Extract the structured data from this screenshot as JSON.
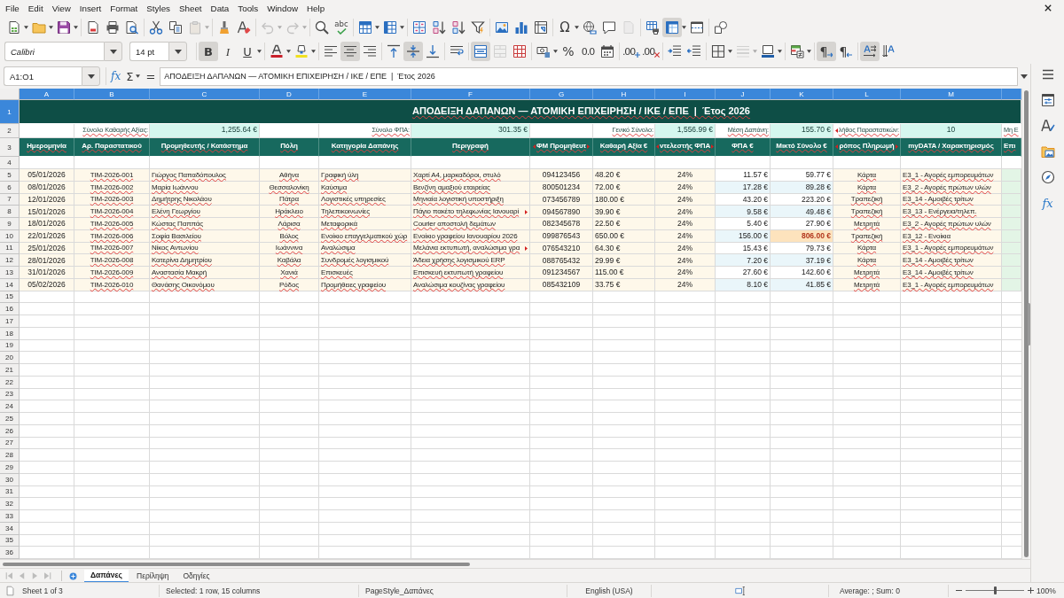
{
  "menu_bar": {
    "items": [
      "File",
      "Edit",
      "View",
      "Insert",
      "Format",
      "Styles",
      "Sheet",
      "Data",
      "Tools",
      "Window",
      "Help"
    ]
  },
  "standard_toolbar": {
    "paste_disabled": true,
    "undo_disabled": true,
    "redo_disabled": true,
    "header_footer_disabled": true,
    "freeze_on": true,
    "spelling_glyph": "abc",
    "special_character_glyph": "Ω"
  },
  "formatting_toolbar": {
    "font_name": "Calibri",
    "font_size": "14 pt",
    "text_styles": [
      {
        "kind": "bold",
        "glyph": "B",
        "on": true
      },
      {
        "kind": "italic",
        "glyph": "I",
        "on": false
      },
      {
        "kind": "underline",
        "glyph": "U",
        "on": false
      }
    ],
    "horizontal_align": [
      {
        "kind": "left",
        "selected": false
      },
      {
        "kind": "center",
        "selected": true
      },
      {
        "kind": "right",
        "selected": false
      }
    ],
    "vertical_align": [
      {
        "kind": "top",
        "selected": false
      },
      {
        "kind": "middle",
        "selected": true
      },
      {
        "kind": "bottom",
        "selected": false
      }
    ],
    "merge_and_center_on": true,
    "merge_cells_disabled": true,
    "percent_glyph": "%",
    "number_glyph": "0.0",
    "decimal_glyphs": [
      ".00",
      ".00"
    ],
    "border_style_disabled": true,
    "paragraph_directions": [
      {
        "kind": "ltr",
        "glyph": "¶",
        "selected": true
      },
      {
        "kind": "rtl",
        "glyph": "¶",
        "selected": false
      }
    ],
    "text_directions": [
      {
        "kind": "horizontal",
        "selected": true
      },
      {
        "kind": "vertical",
        "selected": false
      }
    ]
  },
  "formula_bar": {
    "name_box": "A1:O1",
    "function_glyph": "fx",
    "sum_glyph": "Σ",
    "equals_glyph": "=",
    "formula": "ΑΠΟΔΕΙΞΗ ΔΑΠΑΝΩΝ — ΑΤΟΜΙΚΗ ΕΠΙΧΕΙΡΗΣΗ / ΙΚΕ / ΕΠΕ  |  Έτος 2026"
  },
  "sheet": {
    "column_headers": [
      {
        "label": "A",
        "selected": true
      },
      {
        "label": "B",
        "selected": true
      },
      {
        "label": "C",
        "selected": true
      },
      {
        "label": "D",
        "selected": true
      },
      {
        "label": "E",
        "selected": true
      },
      {
        "label": "F",
        "selected": true
      },
      {
        "label": "G",
        "selected": true
      },
      {
        "label": "H",
        "selected": true
      },
      {
        "label": "I",
        "selected": true
      },
      {
        "label": "J",
        "selected": true
      },
      {
        "label": "K",
        "selected": true
      },
      {
        "label": "L",
        "selected": true
      },
      {
        "label": "M",
        "selected": true
      },
      {
        "selected": true
      }
    ],
    "row_headers": [
      {
        "label": "1",
        "selected": true
      },
      {
        "label": "2",
        "selected": false
      },
      {
        "label": "3",
        "selected": false
      },
      {
        "label": "4",
        "selected": false
      },
      {
        "label": "5",
        "selected": false
      },
      {
        "label": "6",
        "selected": false
      },
      {
        "label": "7",
        "selected": false
      },
      {
        "label": "8",
        "selected": false
      },
      {
        "label": "9",
        "selected": false
      },
      {
        "label": "10",
        "selected": false
      },
      {
        "label": "11",
        "selected": false
      },
      {
        "label": "12",
        "selected": false
      },
      {
        "label": "13",
        "selected": false
      },
      {
        "label": "14",
        "selected": false
      },
      {
        "label": "15",
        "selected": false
      },
      {
        "label": "16",
        "selected": false
      },
      {
        "label": "17",
        "selected": false
      },
      {
        "label": "18",
        "selected": false
      },
      {
        "label": "19",
        "selected": false
      },
      {
        "label": "20",
        "selected": false
      },
      {
        "label": "21",
        "selected": false
      },
      {
        "label": "22",
        "selected": false
      },
      {
        "label": "23",
        "selected": false
      },
      {
        "label": "24",
        "selected": false
      },
      {
        "label": "25",
        "selected": false
      },
      {
        "label": "26",
        "selected": false
      },
      {
        "label": "27",
        "selected": false
      },
      {
        "label": "28",
        "selected": false
      },
      {
        "label": "29",
        "selected": false
      },
      {
        "label": "30",
        "selected": false
      },
      {
        "label": "31",
        "selected": false
      },
      {
        "label": "32",
        "selected": false
      },
      {
        "label": "33",
        "selected": false
      },
      {
        "label": "34",
        "selected": false
      },
      {
        "label": "35",
        "selected": false
      },
      {
        "label": "36",
        "selected": false
      }
    ],
    "title": "ΑΠΟΔΕΙΞΗ ΔΑΠΑΝΩΝ — ΑΤΟΜΙΚΗ ΕΠΙΧΕΙΡΗΣΗ / ΙΚΕ / ΕΠΕ  |  Έτος 2026",
    "summary": [
      {
        "label": "Σύνολο Καθαρής Αξίας:",
        "value": "1,255.64 €",
        "clipped": false
      },
      {
        "label": "Σύνολο ΦΠΑ:",
        "value": "301.35 €",
        "clipped": false
      },
      {
        "label": "Γενικό Σύνολο:",
        "value": "1,556.99 €",
        "clipped": false
      },
      {
        "label": "Μέση Δαπάνη:",
        "value": "155.70 €",
        "clipped": false
      },
      {
        "label": "λήθος Παραστατικών:",
        "value": "10",
        "clipped": true
      },
      {
        "label": "Μη Ε",
        "clipped": false
      }
    ],
    "headers": [
      {
        "text": "Ημερομηνία",
        "clipped": false
      },
      {
        "text": "Αρ. Παραστατικού",
        "clipped": false
      },
      {
        "text": "Προμηθευτής / Κατάστημα",
        "clipped": false
      },
      {
        "text": "Πόλη",
        "clipped": false
      },
      {
        "text": "Κατηγορία Δαπάνης",
        "clipped": false
      },
      {
        "text": "Περιγραφή",
        "clipped": false
      },
      {
        "text": "ΦΜ Προμηθευτ",
        "clipped": true
      },
      {
        "text": "Καθαρή Αξία €",
        "clipped": false
      },
      {
        "text": "ντελεστής ΦΠΑ",
        "clipped": true
      },
      {
        "text": "ΦΠΑ €",
        "clipped": false
      },
      {
        "text": "Μικτό Σύνολο €",
        "clipped": false
      },
      {
        "text": "ρόπος Πληρωμή",
        "clipped": true
      },
      {
        "text": "myDATA / Χαρακτηρισμός",
        "clipped": false
      },
      {
        "text": "Επι",
        "clipped": false
      }
    ],
    "rows": [
      {
        "cells": [
          "05/01/2026",
          "ΤΙΜ-2026-001",
          "Γιώργος Παπαδόπουλος",
          "Αθήνα",
          "Γραφική ύλη",
          "Χαρτί Α4, μαρκαδόροι, στυλό",
          "094123456",
          "48.20 €",
          "24%",
          "11.57 €",
          "59.77 €",
          "Κάρτα",
          "Ε3_1 - Αγορές εμπορευμάτων"
        ],
        "description_clipped": false,
        "total_flagged": false
      },
      {
        "cells": [
          "08/01/2026",
          "ΤΙΜ-2026-002",
          "Μαρία Ιωάννου",
          "Θεσσαλονίκη",
          "Καύσιμα",
          "Βενζίνη αμαξιού εταιρείας",
          "800501234",
          "72.00 €",
          "24%",
          "17.28 €",
          "89.28 €",
          "Κάρτα",
          "Ε3_2 - Αγορές πρώτων υλών"
        ],
        "description_clipped": false,
        "total_flagged": false
      },
      {
        "cells": [
          "12/01/2026",
          "ΤΙΜ-2026-003",
          "Δημήτρης Νικολάου",
          "Πάτρα",
          "Λογιστικές υπηρεσίες",
          "Μηνιαία λογιστική υποστήριξη",
          "073456789",
          "180.00 €",
          "24%",
          "43.20 €",
          "223.20 €",
          "Τραπεζική",
          "Ε3_14 - Αμοιβές τρίτων"
        ],
        "description_clipped": false,
        "total_flagged": false
      },
      {
        "cells": [
          "15/01/2026",
          "ΤΙΜ-2026-004",
          "Ελένη Γεωργίου",
          "Ηράκλειο",
          "Τηλεπικοινωνίες",
          "Πάγιο πακέτο τηλεφωνίας Ιανουαρί",
          "094567890",
          "39.90 €",
          "24%",
          "9.58 €",
          "49.48 €",
          "Τραπεζική",
          "Ε3_13 - Ενέργεια/τηλεπ."
        ],
        "description_clipped": true,
        "total_flagged": false
      },
      {
        "cells": [
          "18/01/2026",
          "ΤΙΜ-2026-005",
          "Κώστας Παππάς",
          "Λάρισα",
          "Μεταφορικά",
          "Courier αποστολή δεμάτων",
          "082345678",
          "22.50 €",
          "24%",
          "5.40 €",
          "27.90 €",
          "Μετρητά",
          "Ε3_2 - Αγορές πρώτων υλών"
        ],
        "description_clipped": false,
        "total_flagged": false
      },
      {
        "cells": [
          "22/01/2026",
          "ΤΙΜ-2026-006",
          "Σοφία Βασιλείου",
          "Βόλος",
          "Ενοίκιο επαγγελματικού χώρ",
          "Ενοίκιο γραφείου Ιανουαρίου 2026",
          "099876543",
          "650.00 €",
          "24%",
          "156.00 €",
          "806.00 €",
          "Τραπεζική",
          "Ε3_12 - Ενοίκια"
        ],
        "description_clipped": false,
        "total_flagged": true
      },
      {
        "cells": [
          "25/01/2026",
          "ΤΙΜ-2026-007",
          "Νίκος Αντωνίου",
          "Ιωάννινα",
          "Αναλώσιμα",
          "Μελάνια εκτυπωτή, αναλώσιμα γρα",
          "076543210",
          "64.30 €",
          "24%",
          "15.43 €",
          "79.73 €",
          "Κάρτα",
          "Ε3_1 - Αγορές εμπορευμάτων"
        ],
        "description_clipped": true,
        "total_flagged": false
      },
      {
        "cells": [
          "28/01/2026",
          "ΤΙΜ-2026-008",
          "Κατερίνα Δημητρίου",
          "Καβάλα",
          "Συνδρομές λογισμικού",
          "Άδεια χρήσης λογισμικού ERP",
          "088765432",
          "29.99 €",
          "24%",
          "7.20 €",
          "37.19 €",
          "Κάρτα",
          "Ε3_14 - Αμοιβές τρίτων"
        ],
        "description_clipped": false,
        "total_flagged": false
      },
      {
        "cells": [
          "31/01/2026",
          "ΤΙΜ-2026-009",
          "Αναστασία Μακρή",
          "Χανιά",
          "Επισκευές",
          "Επισκευή εκτυπωτή γραφείου",
          "091234567",
          "115.00 €",
          "24%",
          "27.60 €",
          "142.60 €",
          "Μετρητά",
          "Ε3_14 - Αμοιβές τρίτων"
        ],
        "description_clipped": false,
        "total_flagged": false
      },
      {
        "cells": [
          "05/02/2026",
          "ΤΙΜ-2026-010",
          "Θανάσης Οικονόμου",
          "Ρόδος",
          "Προμήθειες γραφείου",
          "Αναλώσιμα κουζίνας γραφείου",
          "085432109",
          "33.75 €",
          "24%",
          "8.10 €",
          "41.85 €",
          "Μετρητά",
          "Ε3_1 - Αγορές εμπορευμάτων"
        ],
        "description_clipped": false,
        "total_flagged": false
      }
    ]
  },
  "sheet_tab_bar": {
    "navigation_disabled": true,
    "tabs": [
      {
        "label": "Δαπάνες",
        "selected": true
      },
      {
        "label": "Περίληψη",
        "selected": false
      },
      {
        "label": "Οδηγίες",
        "selected": false
      }
    ]
  },
  "sidebar": {
    "functions_glyph": "fx"
  },
  "status_bar": {
    "sheet_position": "Sheet 1 of 3",
    "selection": "Selected: 1 row, 15 columns",
    "page_style": "PageStyle_Δαπάνες",
    "language": "English (USA)",
    "statistics": "Average: ; Sum: 0",
    "zoom_slider": {
      "level": 0.5
    },
    "zoom": "100%"
  }
}
